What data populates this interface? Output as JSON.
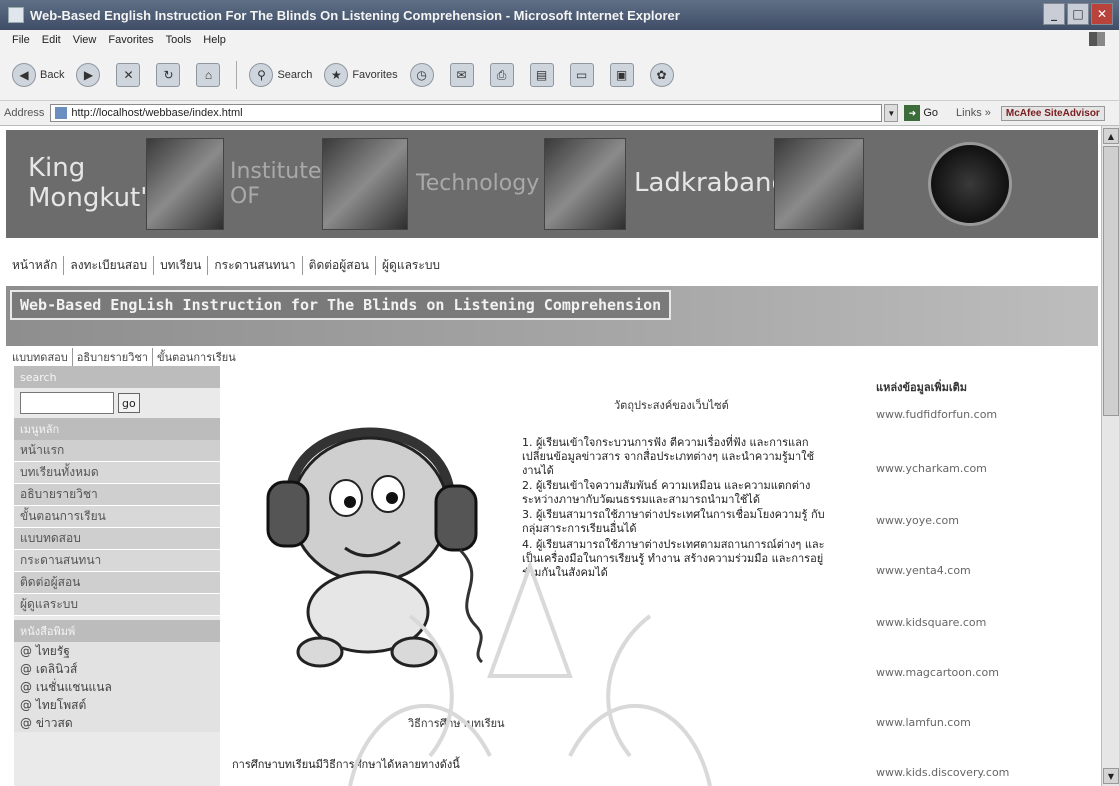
{
  "window": {
    "title": "Web-Based English Instruction For The Blinds On Listening Comprehension - Microsoft Internet Explorer",
    "controls": [
      "_",
      "□",
      "✕"
    ]
  },
  "menubar": [
    "File",
    "Edit",
    "View",
    "Favorites",
    "Tools",
    "Help"
  ],
  "toolbar": {
    "back_label": "Back",
    "search_label": "Search",
    "favorites_label": "Favorites"
  },
  "addressbar": {
    "label": "Address",
    "url": "http://localhost/webbase/index.html",
    "go_label": "Go",
    "links_label": "Links »",
    "addon_label": "McAfee SiteAdvisor"
  },
  "banner": {
    "words": [
      "King Mongkut's",
      "Institute",
      "OF",
      "Technology",
      "Ladkrabang"
    ]
  },
  "nav": [
    "หน้าหลัก",
    "ลงทะเบียนสอบ",
    "บทเรียน",
    "กระดานสนทนา",
    "ติดต่อผู้สอน",
    "ผู้ดูแลระบบ"
  ],
  "header_title": "Web-Based EngLish Instruction for The Blinds on Listening Comprehension",
  "subnav": [
    "แบบทดสอบ",
    "อธิบายรายวิชา",
    "ขั้นตอนการเรียน"
  ],
  "sidebar": {
    "search_heading": "search",
    "search_value": "",
    "go_label": "go",
    "menu_heading": "เมนูหลัก",
    "menu": [
      "หน้าแรก",
      "บทเรียนทั้งหมด",
      "อธิบายรายวิชา",
      "ขั้นตอนการเรียน",
      "แบบทดสอบ",
      "กระดานสนทนา",
      "ติดต่อผู้สอน",
      "ผู้ดูแลระบบ"
    ],
    "papers_heading": "หนังสือพิมพ์",
    "papers": [
      "@ ไทยรัฐ",
      "@ เดลินิวส์",
      "@ เนชั่นแชนแนล",
      "@ ไทยโพสต์",
      "@ ข่าวสด"
    ]
  },
  "main": {
    "objective_title": "วัตถุประสงค์ของเว็บไซต์",
    "objectives": [
      "1. ผู้เรียนเข้าใจกระบวนการฟัง ตีความเรื่องที่ฟัง และการแลกเปลี่ยนข้อมูลข่าวสาร จากสื่อประเภทต่างๆ และนำความรู้มาใช้งานได้",
      "2. ผู้เรียนเข้าใจความสัมพันธ์ ความเหมือน และความแตกต่าง ระหว่างภาษากับวัฒนธรรมและสามารถนำมาใช้ได้",
      "3. ผู้เรียนสามารถใช้ภาษาต่างประเทศในการเชื่อมโยงความรู้ กับกลุ่มสาระการเรียนอื่นได้",
      "4. ผู้เรียนสามารถใช้ภาษาต่างประเทศตามสถานการณ์ต่างๆ และเป็นเครื่องมือในการเรียนรู้ ทำงาน สร้างความร่วมมือ และการอยู่ร่วมกันในสังคมได้"
    ],
    "method_title": "วิธีการศึกษาบทเรียน",
    "method_text": "การศึกษาบทเรียนมีวิธีการศึกษาได้หลายทางดังนี้"
  },
  "right": {
    "heading": "แหล่งข้อมูลเพิ่มเติม",
    "links": [
      "www.fudfidforfun.com",
      "www.ycharkam.com",
      "www.yoye.com",
      "www.yenta4.com",
      "www.kidsquare.com",
      "www.magcartoon.com",
      "www.lamfun.com",
      "www.kids.discovery.com"
    ]
  }
}
